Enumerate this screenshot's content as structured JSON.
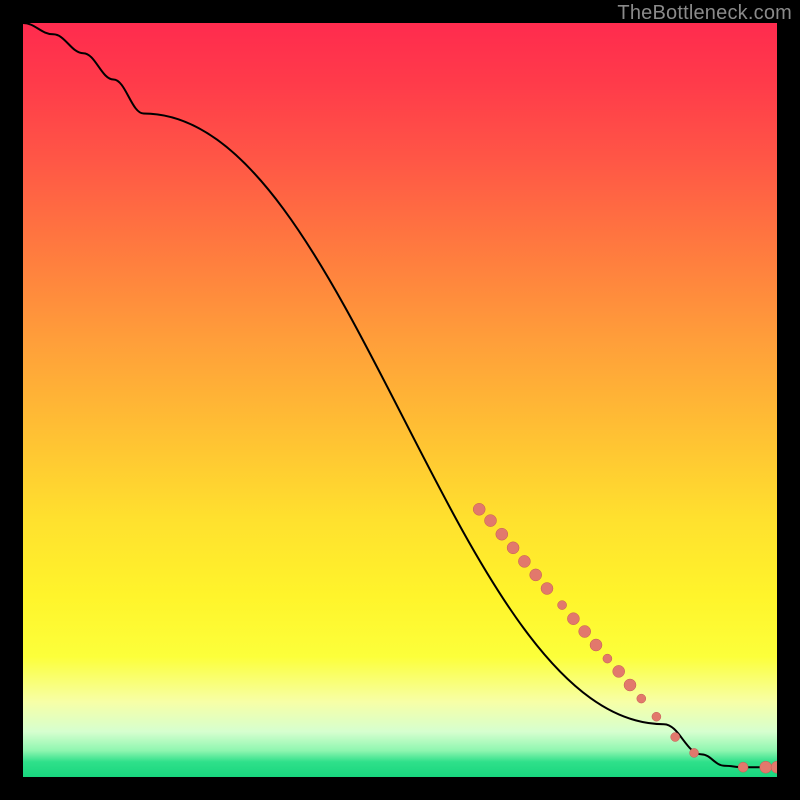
{
  "attribution": "TheBottleneck.com",
  "colors": {
    "marker": "#e2786c",
    "marker_stroke": "#c25c53",
    "line": "#000000"
  },
  "chart_data": {
    "type": "line",
    "title": "",
    "xlabel": "",
    "ylabel": "",
    "xlim": [
      0,
      100
    ],
    "ylim": [
      0,
      100
    ],
    "line_points": [
      {
        "x": 0,
        "y": 100
      },
      {
        "x": 4,
        "y": 98.5
      },
      {
        "x": 8,
        "y": 96
      },
      {
        "x": 12,
        "y": 92.5
      },
      {
        "x": 16,
        "y": 88
      },
      {
        "x": 85,
        "y": 7
      },
      {
        "x": 90,
        "y": 3
      },
      {
        "x": 93,
        "y": 1.5
      },
      {
        "x": 95.5,
        "y": 1.3
      },
      {
        "x": 98,
        "y": 1.3
      },
      {
        "x": 100,
        "y": 1.3
      }
    ],
    "series": [
      {
        "name": "markers",
        "points": [
          {
            "x": 60.5,
            "y": 35.5,
            "r": 6
          },
          {
            "x": 62,
            "y": 34,
            "r": 6
          },
          {
            "x": 63.5,
            "y": 32.2,
            "r": 6
          },
          {
            "x": 65,
            "y": 30.4,
            "r": 6
          },
          {
            "x": 66.5,
            "y": 28.6,
            "r": 6
          },
          {
            "x": 68,
            "y": 26.8,
            "r": 6
          },
          {
            "x": 69.5,
            "y": 25,
            "r": 6
          },
          {
            "x": 71.5,
            "y": 22.8,
            "r": 4.5
          },
          {
            "x": 73,
            "y": 21,
            "r": 6
          },
          {
            "x": 74.5,
            "y": 19.3,
            "r": 6
          },
          {
            "x": 76,
            "y": 17.5,
            "r": 6
          },
          {
            "x": 77.5,
            "y": 15.7,
            "r": 4.5
          },
          {
            "x": 79,
            "y": 14,
            "r": 6
          },
          {
            "x": 80.5,
            "y": 12.2,
            "r": 6
          },
          {
            "x": 82,
            "y": 10.4,
            "r": 4.5
          },
          {
            "x": 84,
            "y": 8,
            "r": 4.5
          },
          {
            "x": 86.5,
            "y": 5.3,
            "r": 4.5
          },
          {
            "x": 89,
            "y": 3.2,
            "r": 4.5
          },
          {
            "x": 95.5,
            "y": 1.3,
            "r": 5
          },
          {
            "x": 98.5,
            "y": 1.3,
            "r": 6
          },
          {
            "x": 100,
            "y": 1.3,
            "r": 6
          }
        ]
      }
    ]
  }
}
